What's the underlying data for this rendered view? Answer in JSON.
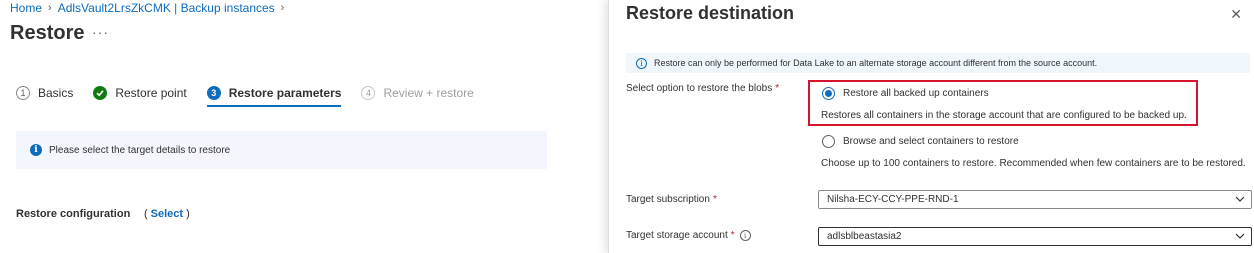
{
  "breadcrumb": [
    "Home",
    "AdlsVault2LrsZkCMK | Backup instances"
  ],
  "page": {
    "title": "Restore",
    "more": "···"
  },
  "steps": [
    {
      "num": "1",
      "label": "Basics",
      "state": "pending"
    },
    {
      "num": "",
      "label": "Restore point",
      "state": "done"
    },
    {
      "num": "3",
      "label": "Restore parameters",
      "state": "active"
    },
    {
      "num": "4",
      "label": "Review + restore",
      "state": "disabled"
    }
  ],
  "info_message": "Please select the target details to restore",
  "restore_config": {
    "label": "Restore configuration",
    "open": "(",
    "link": "Select",
    "close": ")"
  },
  "panel": {
    "title": "Restore destination",
    "close": "✕",
    "banner": "Restore can only be performed for Data Lake  to an alternate storage account different from the source account.",
    "blobs_label": "Select option to restore the blobs",
    "required_mark": "*",
    "options": [
      {
        "label": "Restore all backed up containers",
        "description": "Restores all containers in the storage account that are configured to be backed up.",
        "selected": true
      },
      {
        "label": "Browse and select containers to restore",
        "description": "Choose up to 100 containers to restore. Recommended when few containers are to be restored.",
        "selected": false
      }
    ],
    "subscription": {
      "label": "Target subscription",
      "value": "Nilsha-ECY-CCY-PPE-RND-1"
    },
    "storage_account": {
      "label": "Target storage account",
      "value": "adlsblbeastasia2"
    }
  },
  "colors": {
    "accent": "#0f6cbd",
    "success": "#107c10",
    "highlight": "#d4142a"
  }
}
